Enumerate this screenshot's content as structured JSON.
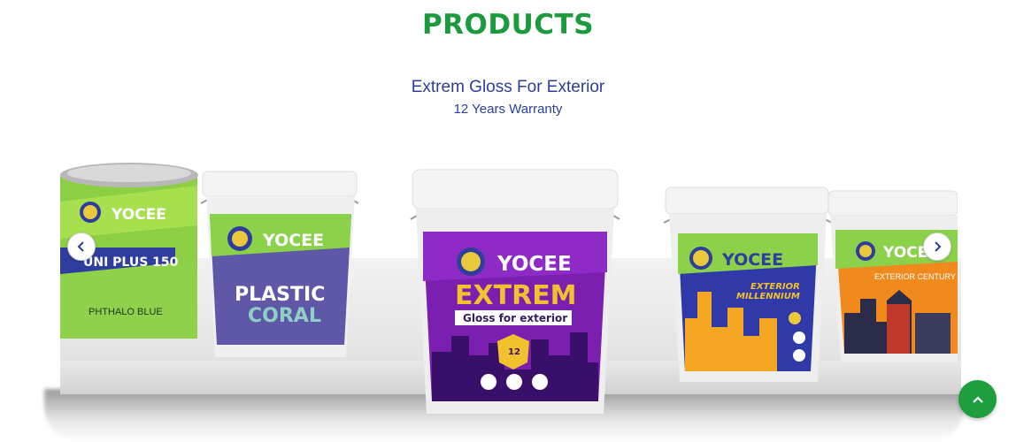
{
  "section": {
    "title": "PRODUCTS",
    "product_name": "Extrem Gloss For Exterior",
    "warranty": "12 Years Warranty"
  },
  "products": [
    {
      "brand": "YOCEE",
      "name": "UNI PLUS 150",
      "sub": "PHTHALO BLUE"
    },
    {
      "brand": "YOCEE",
      "name": "PLASTIC",
      "name2": "CORAL"
    },
    {
      "brand": "YOCEE",
      "name": "EXTREM",
      "sub": "Gloss for exterior",
      "badge": "12"
    },
    {
      "brand": "YOCEE",
      "name": "EXTERIOR",
      "name2": "MILLENNIUM"
    },
    {
      "brand": "YOCEE",
      "name": "EXTERIOR CENTURY"
    }
  ],
  "colors": {
    "title_green": "#1c9a3e",
    "text_blue": "#2b3f9a",
    "button_green": "#1e9e3c"
  },
  "icons": {
    "prev": "chevron-left-icon",
    "next": "chevron-right-icon",
    "scroll_top": "chevron-up-icon"
  }
}
